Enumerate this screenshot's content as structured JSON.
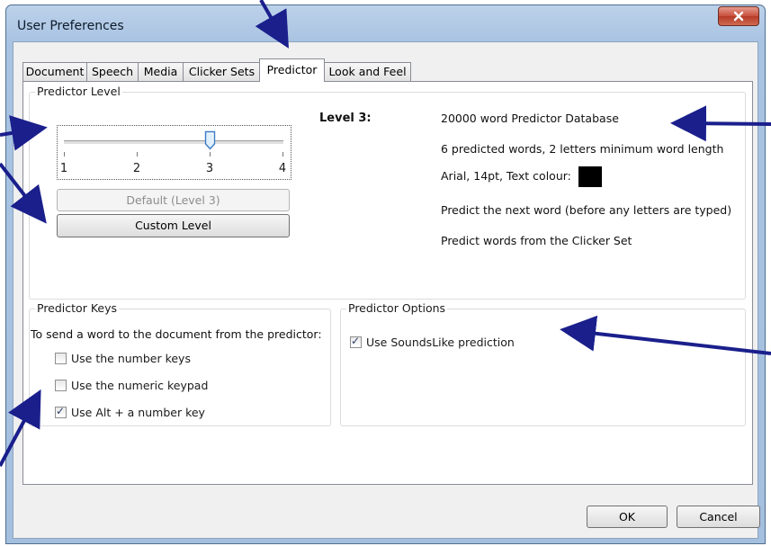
{
  "window": {
    "title": "User Preferences"
  },
  "tabs": [
    {
      "label": "Document",
      "active": false
    },
    {
      "label": "Speech",
      "active": false
    },
    {
      "label": "Media",
      "active": false
    },
    {
      "label": "Clicker Sets",
      "active": false
    },
    {
      "label": "Predictor",
      "active": true
    },
    {
      "label": "Look and Feel",
      "active": false
    }
  ],
  "predictor_level": {
    "group_title": "Predictor Level",
    "slider": {
      "ticks": [
        "1",
        "2",
        "3",
        "4"
      ],
      "value": 3
    },
    "default_button": "Default (Level 3)",
    "custom_button": "Custom Level",
    "level_heading": "Level 3:",
    "details": {
      "database": "20000 word Predictor Database",
      "words": "6 predicted words, 2 letters minimum word length",
      "font": "Arial, 14pt, Text colour:",
      "next_word": "Predict the next word (before any letters are typed)",
      "clicker_set": "Predict words from the Clicker Set"
    },
    "text_colour": "#000000"
  },
  "predictor_keys": {
    "group_title": "Predictor Keys",
    "description": "To send a word to the document from the predictor:",
    "options": [
      {
        "label": "Use the number keys",
        "checked": false
      },
      {
        "label": "Use the numeric keypad",
        "checked": false
      },
      {
        "label": "Use Alt + a number key",
        "checked": true
      }
    ]
  },
  "predictor_options": {
    "group_title": "Predictor Options",
    "options": [
      {
        "label": "Use SoundsLike prediction",
        "checked": true
      }
    ]
  },
  "footer": {
    "ok": "OK",
    "cancel": "Cancel"
  },
  "colors": {
    "annotation_arrow": "#1a1f8c",
    "title_bar": "#a9c3e2",
    "close_button": "#c74f3c"
  },
  "icons": {
    "close": "close-icon",
    "check": "check-icon"
  }
}
